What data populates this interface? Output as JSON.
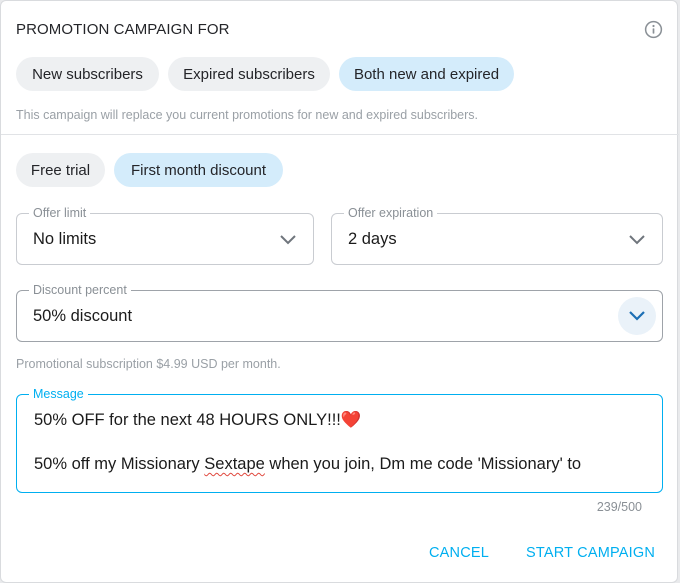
{
  "title": "PROMOTION CAMPAIGN FOR",
  "audience": {
    "options": [
      {
        "label": "New subscribers",
        "selected": false
      },
      {
        "label": "Expired subscribers",
        "selected": false
      },
      {
        "label": "Both new and expired",
        "selected": true
      }
    ],
    "hint": "This campaign will replace you current promotions for new and expired subscribers."
  },
  "offer_type": {
    "options": [
      {
        "label": "Free trial",
        "selected": false
      },
      {
        "label": "First month discount",
        "selected": true
      }
    ]
  },
  "offer_limit": {
    "label": "Offer limit",
    "value": "No limits"
  },
  "offer_expiration": {
    "label": "Offer expiration",
    "value": "2 days"
  },
  "discount_percent": {
    "label": "Discount percent",
    "value": "50% discount"
  },
  "promo_hint": "Promotional subscription $4.99 USD per month.",
  "message": {
    "label": "Message",
    "line1": "50% OFF for the next 48 HOURS ONLY!!!",
    "line1_emoji": "❤️",
    "line2_a": "50% off my Missionary ",
    "line2_misspelled": "Sextape",
    "line2_b": " when you join, Dm me code 'Missionary' to",
    "counter": "239/500"
  },
  "actions": {
    "cancel": "CANCEL",
    "start": "START CAMPAIGN"
  },
  "colors": {
    "accent": "#00aff0",
    "chip_selected_bg": "#d4ecfb",
    "chip_bg": "#eef0f2",
    "hint_text": "#9aa0a6",
    "spellcheck_underline": "#e0483e"
  },
  "icons": [
    "info-icon",
    "chevron-down-icon"
  ]
}
